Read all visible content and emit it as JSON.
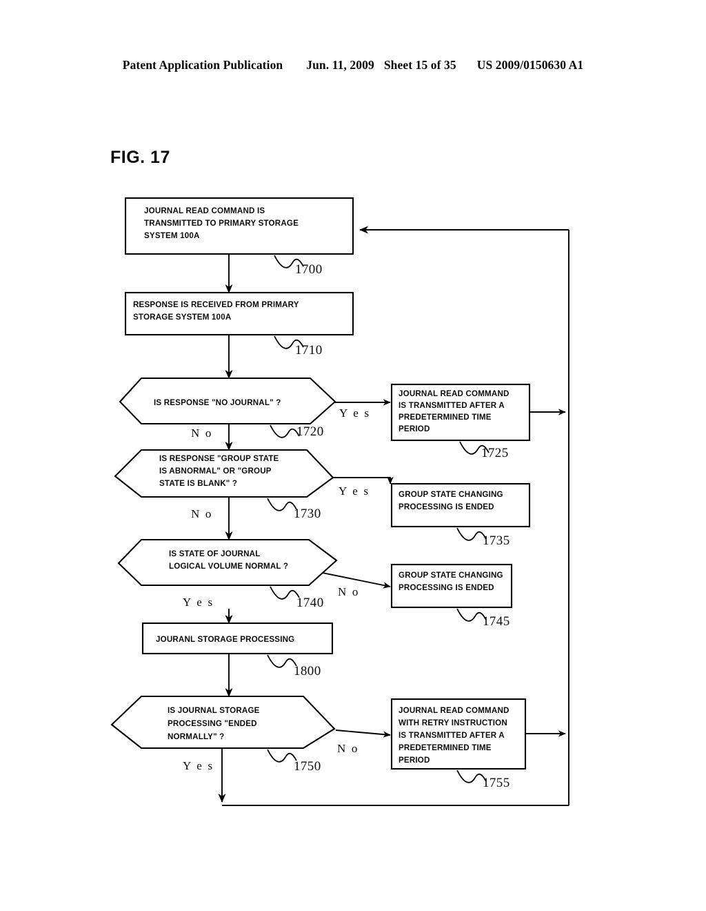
{
  "header": {
    "publication": "Patent Application Publication",
    "date": "Jun. 11, 2009",
    "sheet": "Sheet 15 of 35",
    "docnum": "US 2009/0150630 A1"
  },
  "figure": {
    "label": "FIG. 17"
  },
  "labels": {
    "yes": "Y e s",
    "no": "N o"
  },
  "chart_data": {
    "type": "flowchart",
    "title": "FIG. 17",
    "nodes": [
      {
        "id": "1700",
        "shape": "process",
        "ref": "1700",
        "lines": [
          "JOURNAL READ COMMAND IS",
          "TRANSMITTED TO PRIMARY STORAGE",
          "SYSTEM 100A"
        ]
      },
      {
        "id": "1710",
        "shape": "process",
        "ref": "1710",
        "lines": [
          "RESPONSE IS RECEIVED FROM PRIMARY",
          "STORAGE SYSTEM 100A"
        ]
      },
      {
        "id": "1720",
        "shape": "decision",
        "ref": "1720",
        "lines": [
          "IS RESPONSE \"NO JOURNAL\" ?"
        ]
      },
      {
        "id": "1725",
        "shape": "process",
        "ref": "1725",
        "lines": [
          "JOURNAL READ COMMAND",
          "IS TRANSMITTED AFTER A",
          "PREDETERMINED TIME",
          "PERIOD"
        ]
      },
      {
        "id": "1730",
        "shape": "decision",
        "ref": "1730",
        "lines": [
          "IS RESPONSE \"GROUP STATE",
          "IS ABNORMAL\" OR \"GROUP",
          "STATE IS BLANK\" ?"
        ]
      },
      {
        "id": "1735",
        "shape": "process",
        "ref": "1735",
        "lines": [
          "GROUP STATE CHANGING",
          "PROCESSING IS ENDED"
        ]
      },
      {
        "id": "1740",
        "shape": "decision",
        "ref": "1740",
        "lines": [
          "IS STATE OF JOURNAL",
          "LOGICAL VOLUME NORMAL ?"
        ]
      },
      {
        "id": "1745",
        "shape": "process",
        "ref": "1745",
        "lines": [
          "GROUP STATE CHANGING",
          "PROCESSING IS ENDED"
        ]
      },
      {
        "id": "1800",
        "shape": "process",
        "ref": "1800",
        "lines": [
          "JOURANL STORAGE PROCESSING"
        ]
      },
      {
        "id": "1750",
        "shape": "decision",
        "ref": "1750",
        "lines": [
          "IS JOURNAL STORAGE",
          "PROCESSING \"ENDED",
          "NORMALLY\" ?"
        ]
      },
      {
        "id": "1755",
        "shape": "process",
        "ref": "1755",
        "lines": [
          "JOURNAL READ COMMAND",
          "WITH RETRY INSTRUCTION",
          "IS TRANSMITTED AFTER A",
          "PREDETERMINED TIME",
          "PERIOD"
        ]
      }
    ],
    "edges": [
      {
        "from": "1700",
        "to": "1710",
        "label": ""
      },
      {
        "from": "1710",
        "to": "1720",
        "label": ""
      },
      {
        "from": "1720",
        "to": "1725",
        "label": "Y e s"
      },
      {
        "from": "1720",
        "to": "1730",
        "label": "N o"
      },
      {
        "from": "1730",
        "to": "1735",
        "label": "Y e s"
      },
      {
        "from": "1730",
        "to": "1740",
        "label": "N o"
      },
      {
        "from": "1740",
        "to": "1745",
        "label": "N o"
      },
      {
        "from": "1740",
        "to": "1800",
        "label": "Y e s"
      },
      {
        "from": "1800",
        "to": "1750",
        "label": ""
      },
      {
        "from": "1750",
        "to": "1755",
        "label": "N o"
      },
      {
        "from": "1750",
        "to": "1700",
        "label": "Y e s"
      },
      {
        "from": "1725",
        "to": "1700",
        "label": ""
      },
      {
        "from": "1755",
        "to": "1700",
        "label": ""
      }
    ]
  },
  "refs": {
    "n1700": "1700",
    "n1710": "1710",
    "n1720": "1720",
    "n1725": "1725",
    "n1730": "1730",
    "n1735": "1735",
    "n1740": "1740",
    "n1745": "1745",
    "n1750": "1750",
    "n1755": "1755",
    "n1800": "1800"
  },
  "text": {
    "b1700_l1": "JOURNAL READ COMMAND IS",
    "b1700_l2": "TRANSMITTED TO PRIMARY STORAGE",
    "b1700_l3": "SYSTEM 100A",
    "b1710_l1": "RESPONSE IS RECEIVED FROM PRIMARY",
    "b1710_l2": "STORAGE SYSTEM 100A",
    "d1720_l1": "IS RESPONSE \"NO JOURNAL\" ?",
    "b1725_l1": "JOURNAL READ COMMAND",
    "b1725_l2": "IS TRANSMITTED AFTER A",
    "b1725_l3": "PREDETERMINED TIME",
    "b1725_l4": "PERIOD",
    "d1730_l1": "IS RESPONSE \"GROUP STATE",
    "d1730_l2": "IS ABNORMAL\" OR \"GROUP",
    "d1730_l3": "STATE IS BLANK\" ?",
    "b1735_l1": "GROUP STATE CHANGING",
    "b1735_l2": "PROCESSING IS ENDED",
    "d1740_l1": "IS STATE OF JOURNAL",
    "d1740_l2": "LOGICAL VOLUME NORMAL ?",
    "b1745_l1": "GROUP STATE CHANGING",
    "b1745_l2": "PROCESSING IS ENDED",
    "b1800_l1": "JOURANL STORAGE PROCESSING",
    "d1750_l1": "IS JOURNAL STORAGE",
    "d1750_l2": "PROCESSING \"ENDED",
    "d1750_l3": "NORMALLY\" ?",
    "b1755_l1": "JOURNAL READ COMMAND",
    "b1755_l2": "WITH RETRY INSTRUCTION",
    "b1755_l3": "IS TRANSMITTED AFTER A",
    "b1755_l4": "PREDETERMINED TIME",
    "b1755_l5": "PERIOD"
  },
  "branches": {
    "yes1720": "Y e s",
    "no1720": "N o",
    "yes1730": "Y e s",
    "no1730": "N o",
    "no1740": "N o",
    "yes1740": "Y e s",
    "no1750": "N o",
    "yes1750": "Y e s"
  },
  "colors": {
    "ink": "#0b0b0b",
    "paper": "#fefefe"
  }
}
